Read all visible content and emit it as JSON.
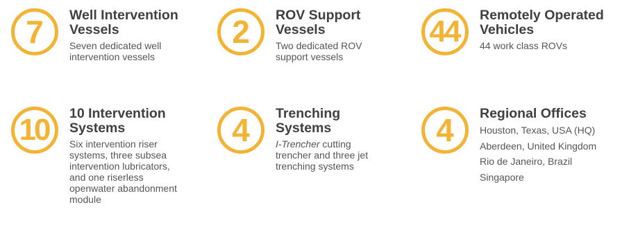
{
  "colors": {
    "accent": "#f5b335",
    "title_text": "#404040",
    "body_text": "#555555"
  },
  "stats": [
    {
      "number": "7",
      "title_lines": [
        "Well Intervention",
        "Vessels"
      ],
      "desc_lines": [
        "Seven dedicated well",
        "intervention vessels"
      ]
    },
    {
      "number": "2",
      "title_lines": [
        "ROV Support",
        "Vessels"
      ],
      "desc_lines": [
        "Two dedicated ROV",
        "support vessels"
      ]
    },
    {
      "number": "44",
      "title_lines": [
        "Remotely Operated",
        "Vehicles"
      ],
      "desc_lines": [
        "44 work class ROVs"
      ]
    },
    {
      "number": "10",
      "title_lines": [
        "10 Intervention",
        "Systems"
      ],
      "desc_lines": [
        "Six intervention riser",
        "systems, three subsea",
        "intervention lubricators,",
        "and one riserless",
        "openwater abandonment",
        "module"
      ]
    },
    {
      "number": "4",
      "title_lines": [
        "Trenching",
        "Systems"
      ],
      "desc_italic": "I-Trencher",
      "desc_lines": [
        " cutting",
        "trencher and three jet",
        "trenching systems"
      ]
    },
    {
      "number": "4",
      "title_lines": [
        "Regional Offices"
      ],
      "desc_lines": [
        "Houston, Texas, USA (HQ)",
        "Aberdeen, United Kingdom",
        "Rio de Janeiro, Brazil",
        "Singapore"
      ]
    }
  ]
}
